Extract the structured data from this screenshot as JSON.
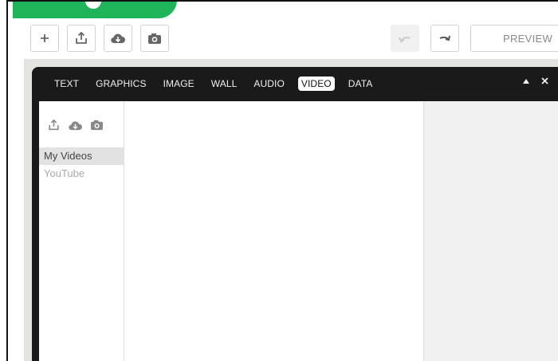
{
  "toolbar": {
    "buttons": [
      {
        "name": "add-button",
        "icon": "plus-icon"
      },
      {
        "name": "upload-button",
        "icon": "upload-icon"
      },
      {
        "name": "cloud-download-button",
        "icon": "cloud-download-icon"
      },
      {
        "name": "camera-button",
        "icon": "camera-icon"
      }
    ],
    "undo_icon": "undo-icon",
    "redo_icon": "redo-icon",
    "preview_label": "PREVIEW"
  },
  "panel": {
    "tabs": [
      {
        "label": "TEXT",
        "active": false
      },
      {
        "label": "GRAPHICS",
        "active": false
      },
      {
        "label": "IMAGE",
        "active": false
      },
      {
        "label": "WALL",
        "active": false
      },
      {
        "label": "AUDIO",
        "active": false
      },
      {
        "label": "VIDEO",
        "active": true
      },
      {
        "label": "DATA",
        "active": false
      }
    ],
    "controls": [
      "collapse-icon",
      "close-icon"
    ]
  },
  "sidebar": {
    "icons": [
      "upload-icon",
      "cloud-download-icon",
      "camera-icon"
    ],
    "items": [
      {
        "label": "My Videos",
        "selected": true
      },
      {
        "label": "YouTube",
        "selected": false
      }
    ]
  },
  "colors": {
    "brand_green": "#1fb35a",
    "panel_dark": "#1a1a1a",
    "backdrop": "#e3e4e0"
  }
}
